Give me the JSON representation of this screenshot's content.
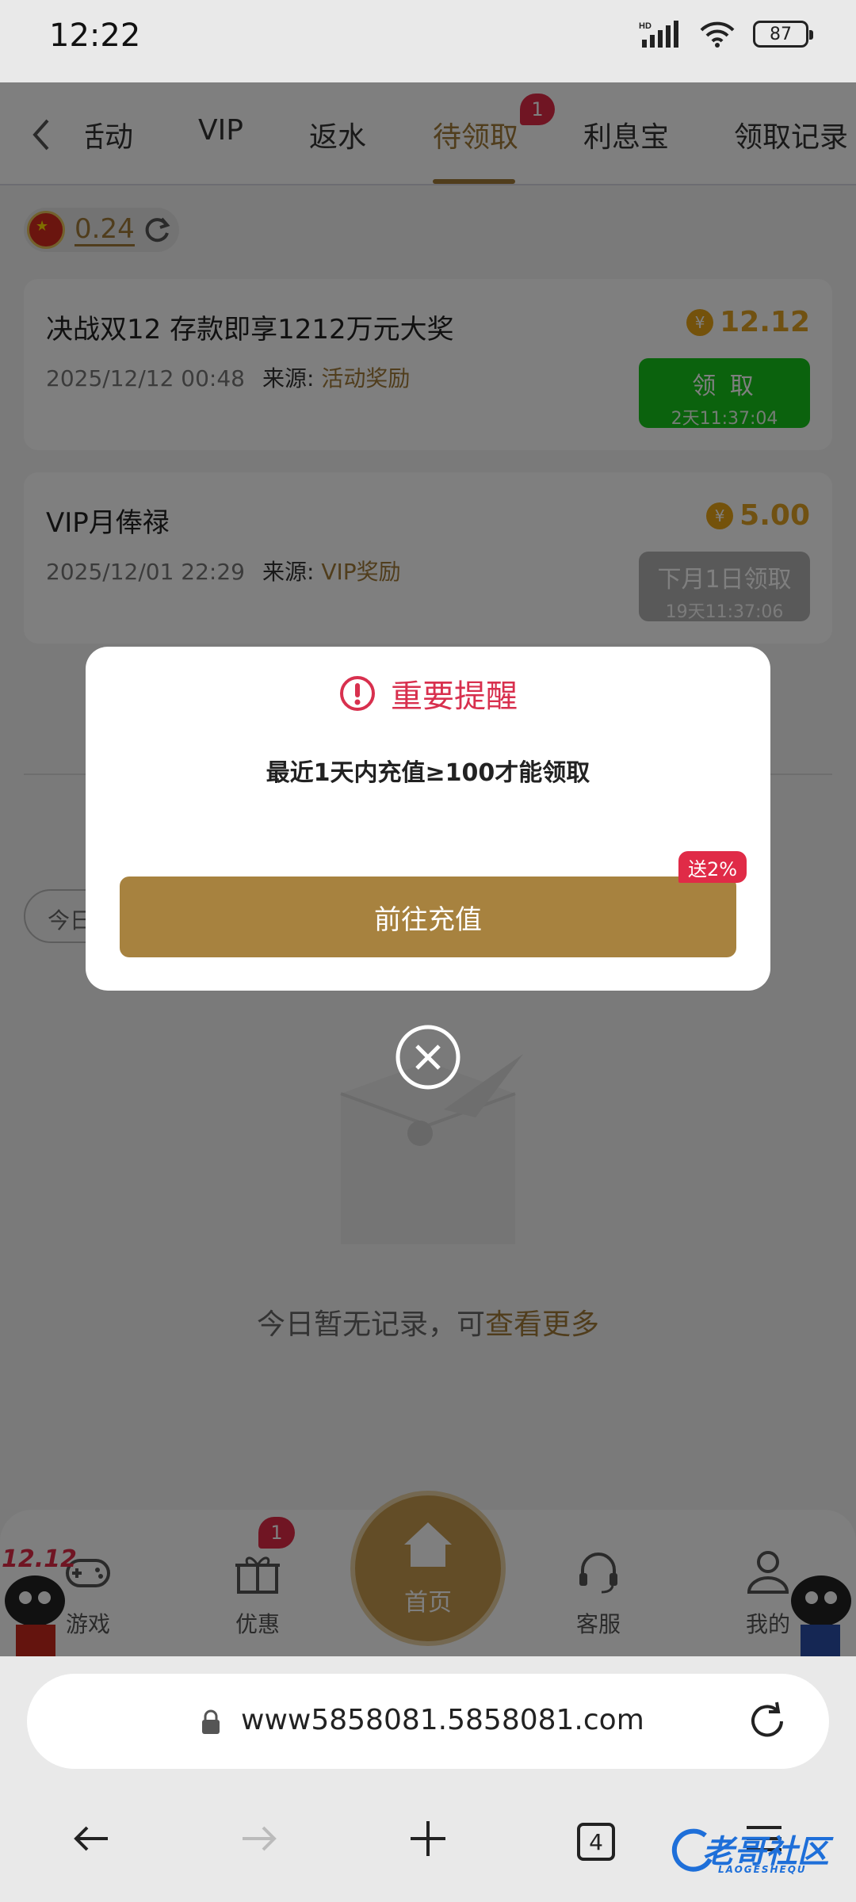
{
  "status_bar": {
    "time": "12:22",
    "battery": "87",
    "network": "HD"
  },
  "tabs": {
    "items": [
      {
        "label": "活动"
      },
      {
        "label": "VIP"
      },
      {
        "label": "返水"
      },
      {
        "label": "待领取",
        "badge": "1",
        "active": true
      },
      {
        "label": "利息宝"
      },
      {
        "label": "领取记录"
      }
    ]
  },
  "balance": {
    "value": "0.24"
  },
  "rewards": [
    {
      "title": "决战双12 存款即享1212万元大奖",
      "date": "2025/12/12 00:48",
      "source_label": "来源:",
      "source": "活动奖励",
      "amount": "12.12",
      "button_label": "领 取",
      "button_sub": "2天11:37:04",
      "button_color": "#16c41a"
    },
    {
      "title": "VIP月俸禄",
      "date": "2025/12/01 22:29",
      "source_label": "来源:",
      "source": "VIP奖励",
      "amount": "5.00",
      "button_label": "下月1日领取",
      "button_sub": "19天11:37:06",
      "button_color": "#b3b3b3"
    }
  ],
  "filter": {
    "today_label": "今日"
  },
  "empty_state": {
    "text": "今日暂无记录，可",
    "link": "查看更多"
  },
  "bottom_nav": {
    "items": [
      {
        "label": "游戏"
      },
      {
        "label": "优惠",
        "badge": "1"
      },
      {
        "label": "首页"
      },
      {
        "label": "客服"
      },
      {
        "label": "我的"
      }
    ],
    "promo": "12.12"
  },
  "modal": {
    "title": "重要提醒",
    "message": "最近1天内充值≥100才能领取",
    "button_label": "前往充值",
    "tag": "送2%"
  },
  "browser": {
    "url": "www5858081.5858081.com",
    "tab_count": "4"
  },
  "watermark": {
    "text": "老哥社区",
    "sub": "LAOGESHEQU"
  },
  "colors": {
    "accent": "#a17a38",
    "alert": "#d8304e",
    "claim_green": "#16c41a",
    "badge_red": "#e02b47"
  }
}
